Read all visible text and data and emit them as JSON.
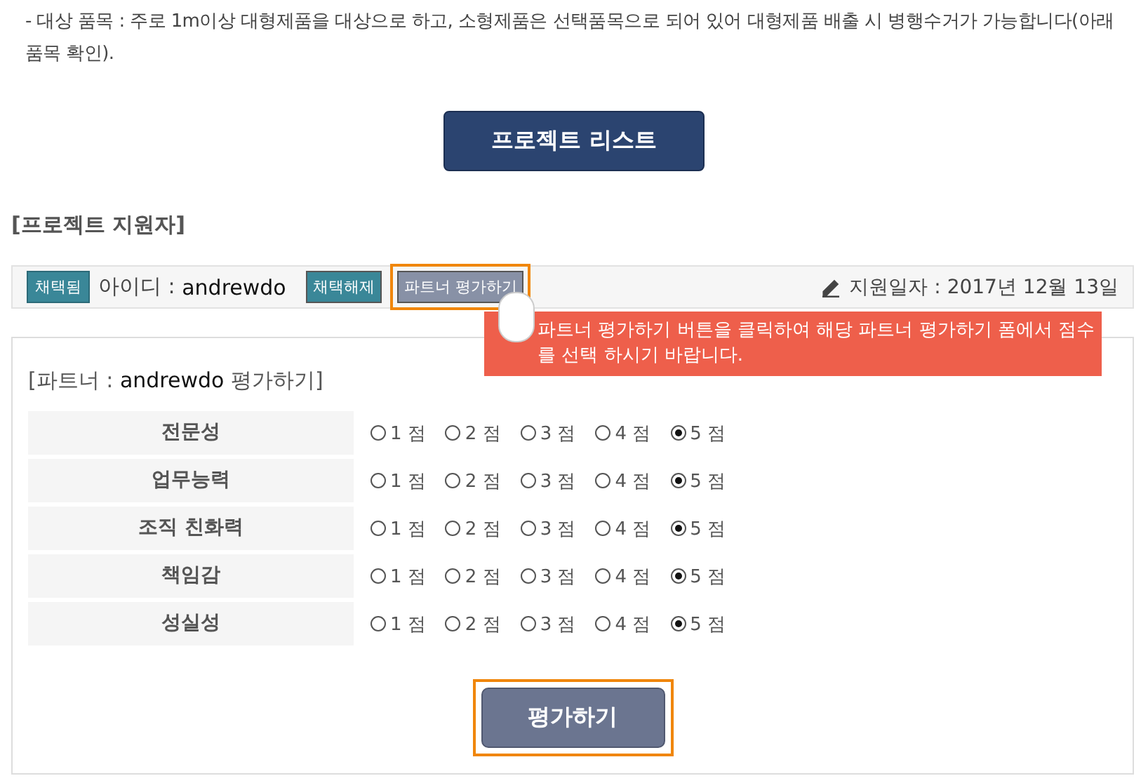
{
  "notice": "- 대상 품목 : 주로 1m이상 대형제품을 대상으로 하고, 소형제품은 선택품목으로 되어 있어 대형제품 배출 시 병행수거가 가능합니다(아래 품목 확인).",
  "project_list_button": "프로젝트 리스트",
  "applicants_heading": "[프로젝트 지원자]",
  "applicant": {
    "status_badge": "채택됨",
    "id_label": "아이디 : ",
    "id": "andrewdo",
    "unselect_button": "채택해제",
    "evaluate_button": "파트너 평가하기",
    "evaluate_highlighted": true,
    "date": "지원일자 : 2017년 12월 13일"
  },
  "tooltip": "파트너 평가하기 버튼을 클릭하여 해당 파트너 평가하기 폼에서 점수를 선택 하시기 바랍니다.",
  "form": {
    "title_prefix": "[파트너 : ",
    "partner": "andrewdo",
    "title_suffix": " 평가하기]",
    "criteria": [
      {
        "label": "전문성",
        "options": [
          {
            "label": "1 점",
            "selected": false
          },
          {
            "label": "2 점",
            "selected": false
          },
          {
            "label": "3 점",
            "selected": false
          },
          {
            "label": "4 점",
            "selected": false
          },
          {
            "label": "5 점",
            "selected": true
          }
        ]
      },
      {
        "label": "업무능력",
        "options": [
          {
            "label": "1 점",
            "selected": false
          },
          {
            "label": "2 점",
            "selected": false
          },
          {
            "label": "3 점",
            "selected": false
          },
          {
            "label": "4 점",
            "selected": false
          },
          {
            "label": "5 점",
            "selected": true
          }
        ]
      },
      {
        "label": "조직 친화력",
        "options": [
          {
            "label": "1 점",
            "selected": false
          },
          {
            "label": "2 점",
            "selected": false
          },
          {
            "label": "3 점",
            "selected": false
          },
          {
            "label": "4 점",
            "selected": false
          },
          {
            "label": "5 점",
            "selected": true
          }
        ]
      },
      {
        "label": "책임감",
        "options": [
          {
            "label": "1 점",
            "selected": false
          },
          {
            "label": "2 점",
            "selected": false
          },
          {
            "label": "3 점",
            "selected": false
          },
          {
            "label": "4 점",
            "selected": false
          },
          {
            "label": "5 점",
            "selected": true
          }
        ]
      },
      {
        "label": "성실성",
        "options": [
          {
            "label": "1 점",
            "selected": false
          },
          {
            "label": "2 점",
            "selected": false
          },
          {
            "label": "3 점",
            "selected": false
          },
          {
            "label": "4 점",
            "selected": false
          },
          {
            "label": "5 점",
            "selected": true
          }
        ]
      }
    ],
    "submit_button": "평가하기",
    "submit_highlighted": true
  }
}
